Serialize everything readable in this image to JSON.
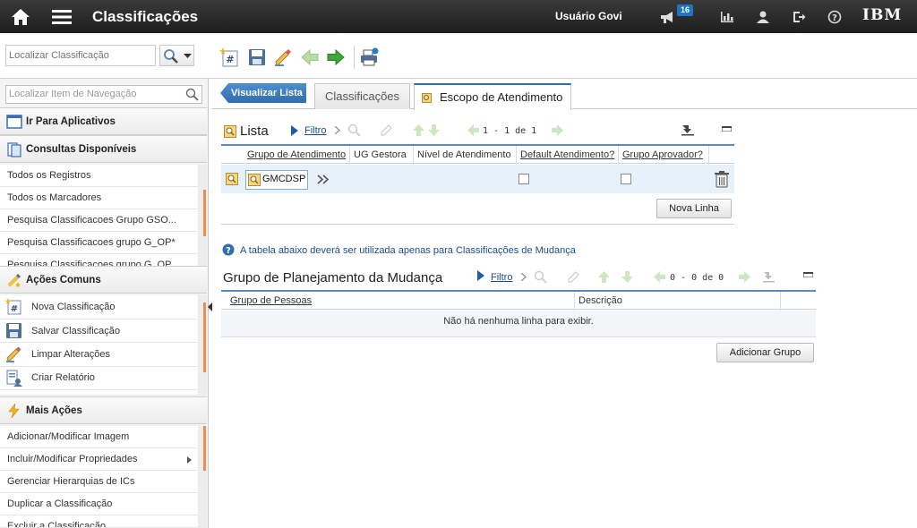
{
  "header": {
    "app_title": "Classificações",
    "user_name": "Usuário Govi",
    "notification_count": "16",
    "brand": "IBM"
  },
  "toolbar": {
    "search_placeholder": "Localizar Classificação"
  },
  "nav": {
    "search_placeholder": "Localizar Item de Navegação",
    "goto_apps": "Ir Para Aplicativos",
    "queries_title": "Consultas Disponíveis",
    "queries": [
      "Todos os Registros",
      "Todos os Marcadores",
      "Pesquisa Classificacoes Grupo GSO...",
      "Pesquisa Classificacoes grupo G_OP*",
      "Pesquisa Classificacoes grupo G_OP..."
    ],
    "common_title": "Ações Comuns",
    "common": [
      "Nova Classificação",
      "Salvar Classificação",
      "Limpar Alterações",
      "Criar Relatório"
    ],
    "more_title": "Mais Ações",
    "more": [
      "Adicionar/Modificar Imagem",
      "Incluir/Modificar Propriedades",
      "Gerenciar Hierarquias de ICs",
      "Duplicar a Classificação",
      "Excluir a Classificação"
    ]
  },
  "tabs": {
    "back": "Visualizar Lista",
    "classifications": "Classificações",
    "scope": "Escopo de Atendimento"
  },
  "lista": {
    "title": "Lista",
    "filter": "Filtro",
    "pager": "1 - 1 de 1",
    "columns": [
      "Grupo de Atendimento",
      "UG Gestora",
      "Nível de Atendimento",
      "Default Atendimento?",
      "Grupo Aprovador?"
    ],
    "row": {
      "group": "GMCDSP"
    },
    "new_row": "Nova Linha"
  },
  "info_text": "A tabela abaixo deverá ser utilizada apenas para Classificações de Mudança",
  "planning": {
    "title": "Grupo de Planejamento da Mudança",
    "filter": "Filtro",
    "pager": "0 - 0 de 0",
    "columns": [
      "Grupo de Pessoas",
      "Descrição"
    ],
    "empty": "Não há nenhuma linha para exibir.",
    "add_group": "Adicionar Grupo"
  },
  "colors": {
    "accent": "#2e6eb0",
    "scroll_thumb": "#f08a54",
    "selected_row": "#e6f1fa"
  }
}
